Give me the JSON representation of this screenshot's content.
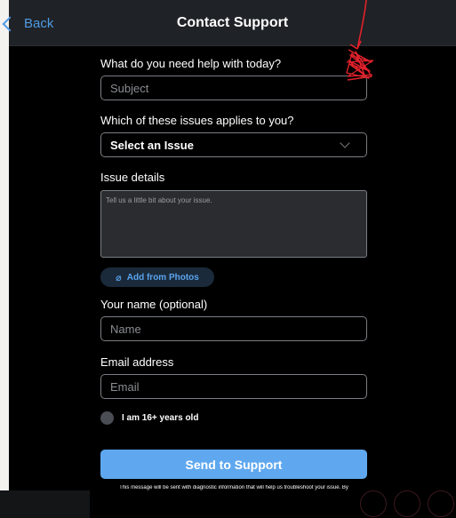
{
  "header": {
    "back_label": "Back",
    "title": "Contact Support"
  },
  "form": {
    "subject_label": "What do you need help with today?",
    "subject_placeholder": "Subject",
    "issue_label": "Which of these issues applies to you?",
    "issue_selected": "Select an Issue",
    "details_label": "Issue details",
    "details_placeholder": "Tell us a little bit about your issue.",
    "add_photos_label": "Add from Photos",
    "name_label": "Your name (optional)",
    "name_placeholder": "Name",
    "email_label": "Email address",
    "email_placeholder": "Email",
    "age_label": "I am 16+ years old",
    "send_label": "Send to Support",
    "footer_note": "This message will be sent with diagnostic information that will help us troubleshoot your issue. By"
  },
  "colors": {
    "accent": "#4f9be5",
    "send_button": "#5fa8ef",
    "background": "#000000",
    "header_bg": "#1f2226",
    "annotation": "#e0212b"
  },
  "icons": {
    "back": "chevron-left-icon",
    "dropdown": "chevron-down-icon",
    "attach": "paperclip-icon",
    "checkbox": "radio-circle-icon"
  }
}
